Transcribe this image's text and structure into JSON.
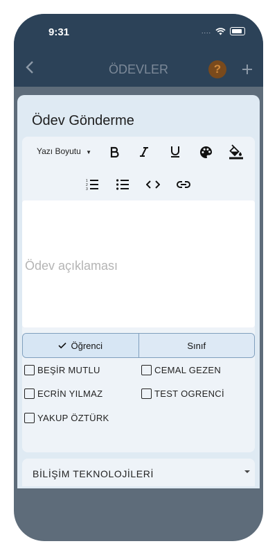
{
  "status_bar": {
    "time": "9:31",
    "signal": "....",
    "icons": [
      "wifi-icon",
      "battery-icon"
    ]
  },
  "nav": {
    "title": "ÖDEVLER",
    "back_icon": "chevron-left-icon",
    "help_label": "?",
    "add_icon": "plus-icon"
  },
  "sheet": {
    "title": "Ödev Gönderme"
  },
  "toolbar": {
    "font_size_label": "Yazı Boyutu",
    "buttons": [
      "bold-icon",
      "italic-icon",
      "underline-icon",
      "palette-icon",
      "fill-color-icon"
    ],
    "buttons_row2": [
      "ordered-list-icon",
      "bullet-list-icon",
      "code-icon",
      "link-icon"
    ]
  },
  "editor": {
    "placeholder": "Ödev açıklaması"
  },
  "segment": {
    "options": [
      {
        "label": "Öğrenci",
        "selected": true
      },
      {
        "label": "Sınıf",
        "selected": false
      }
    ]
  },
  "students": [
    {
      "name": "BEŞİR MUTLU",
      "checked": false
    },
    {
      "name": "CEMAL GEZEN",
      "checked": false
    },
    {
      "name": "ECRİN YILMAZ",
      "checked": false
    },
    {
      "name": "TEST OGRENCİ",
      "checked": false
    },
    {
      "name": "YAKUP ÖZTÜRK",
      "checked": false
    }
  ],
  "course_select": {
    "value": "BİLİŞİM TEKNOLOJİLERİ"
  },
  "colors": {
    "header": "#2c4258",
    "sheet": "#dfeaf3",
    "panel": "#eef3f8",
    "segment_selected": "#d7e6f4",
    "help": "#7a4a1c"
  }
}
